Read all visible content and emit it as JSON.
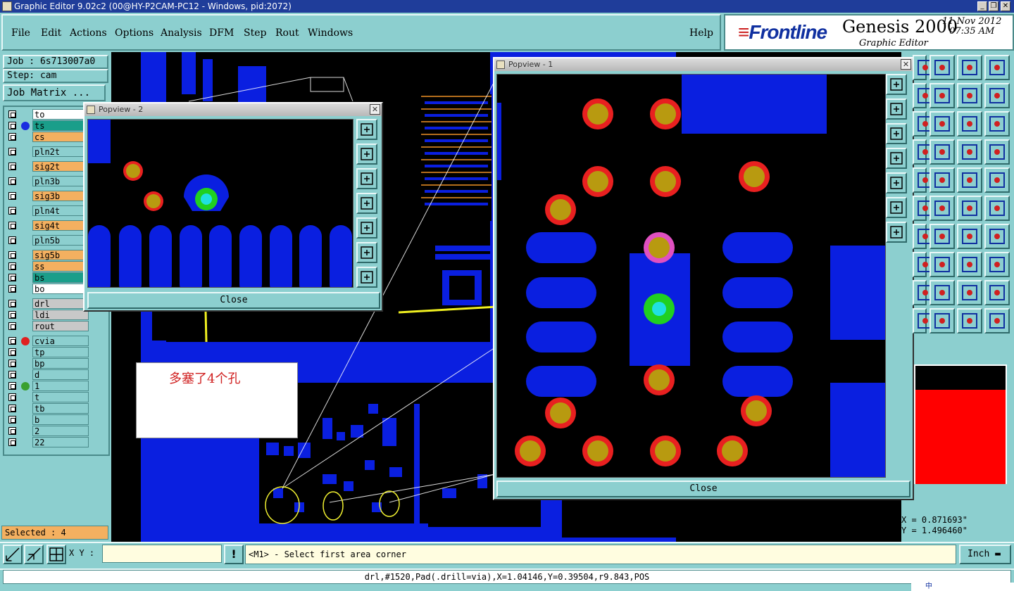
{
  "window": {
    "title": "Graphic Editor 9.02c2 (00@HY-P2CAM-PC12 - Windows, pid:2072)"
  },
  "menu": {
    "items": [
      "File",
      "Edit",
      "Actions",
      "Options",
      "Analysis",
      "DFM",
      "Step",
      "Rout",
      "Windows"
    ],
    "help": "Help"
  },
  "brand": {
    "logo": "Frontline",
    "product": "Genesis 2000",
    "subtitle": "Graphic Editor",
    "date": "11 Nov 2012",
    "time": "07:35 AM"
  },
  "job": {
    "job_label": "Job : 6s713007a0",
    "step_label": "Step: cam",
    "matrix_button": "Job Matrix ..."
  },
  "layers": [
    {
      "name": "to",
      "color": "#ffffff"
    },
    {
      "name": "ts",
      "color": "#1a9e8a",
      "dot": "#1a2ee0"
    },
    {
      "name": "cs",
      "color": "#f4b060"
    },
    {
      "name": "pln2t",
      "color": "#8ccfcf"
    },
    {
      "name": "sig2t",
      "color": "#f4b060"
    },
    {
      "name": "pln3b",
      "color": "#8ccfcf"
    },
    {
      "name": "sig3b",
      "color": "#f4b060"
    },
    {
      "name": "pln4t",
      "color": "#8ccfcf"
    },
    {
      "name": "sig4t",
      "color": "#f4b060"
    },
    {
      "name": "pln5b",
      "color": "#8ccfcf"
    },
    {
      "name": "sig5b",
      "color": "#f4b060"
    },
    {
      "name": "ss",
      "color": "#f4b060"
    },
    {
      "name": "bs",
      "color": "#1a9e8a"
    },
    {
      "name": "bo",
      "color": "#ffffff"
    },
    {
      "name": "drl",
      "color": "#c8c8c8"
    },
    {
      "name": "ldi",
      "color": "#c8c8c8"
    },
    {
      "name": "rout",
      "color": "#c8c8c8"
    },
    {
      "name": "cvia",
      "color": "#8ccfcf",
      "dot": "#e02020"
    },
    {
      "name": "tp",
      "color": "#8ccfcf"
    },
    {
      "name": "bp",
      "color": "#8ccfcf"
    },
    {
      "name": "d",
      "color": "#8ccfcf"
    },
    {
      "name": "1",
      "color": "#8ccfcf",
      "dot": "#3aa030"
    },
    {
      "name": "t",
      "color": "#8ccfcf"
    },
    {
      "name": "tb",
      "color": "#8ccfcf"
    },
    {
      "name": "b",
      "color": "#8ccfcf"
    },
    {
      "name": "2",
      "color": "#8ccfcf"
    },
    {
      "name": "22",
      "color": "#8ccfcf"
    }
  ],
  "selected": "Selected : 4",
  "popview1": {
    "title": "Popview - 1",
    "close": "Close"
  },
  "popview2": {
    "title": "Popview - 2",
    "close": "Close"
  },
  "annotation": "多塞了4个孔",
  "coords": {
    "x": "X = 0.871693\"",
    "y": "Y = 1.496460\""
  },
  "xy_label": "X Y :",
  "prompt": "<M1> - Select first area corner",
  "units": "Inch",
  "info": "drl,#1520,Pad(.drill=via),X=1.04146,Y=0.39504,r9.843,POS",
  "tray": "中"
}
